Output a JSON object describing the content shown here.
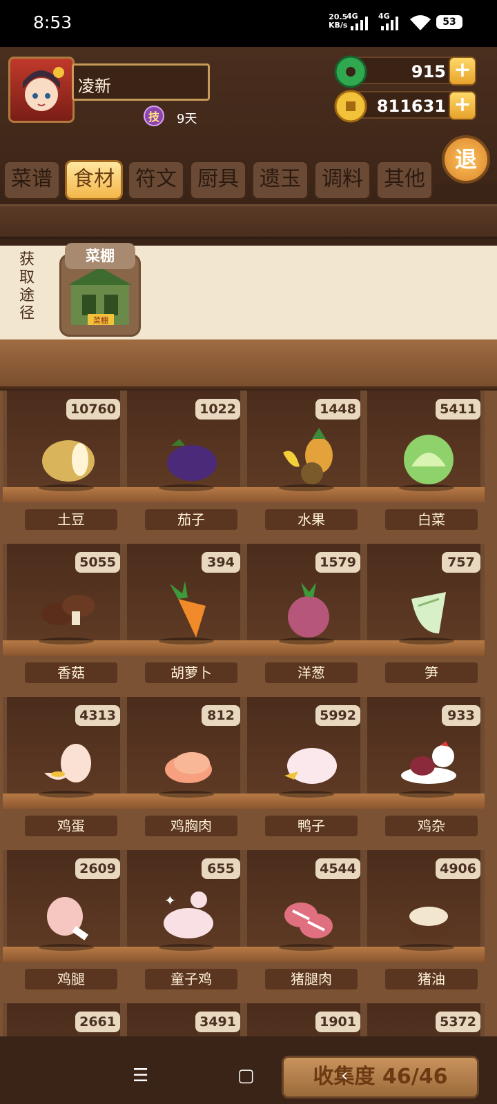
{
  "status_bar": {
    "time": "8:53",
    "net_speed": "20.5",
    "net_unit": "KB/s",
    "signal1": "4G",
    "signal2": "4G",
    "battery": "53"
  },
  "player": {
    "name": "凌新",
    "skill_badge": "技",
    "days": "9天"
  },
  "currency": {
    "jade": "915",
    "coins": "811631"
  },
  "exit_label": "退",
  "tabs": [
    "菜谱",
    "食材",
    "符文",
    "厨具",
    "遗玉",
    "调料",
    "其他"
  ],
  "active_tab": 1,
  "source": {
    "label": "获取途径",
    "title": "菜棚",
    "building_sign": "菜棚"
  },
  "items": [
    {
      "name": "土豆",
      "count": "10760",
      "icon": "potato-icon"
    },
    {
      "name": "茄子",
      "count": "1022",
      "icon": "eggplant-icon"
    },
    {
      "name": "水果",
      "count": "1448",
      "icon": "fruit-icon"
    },
    {
      "name": "白菜",
      "count": "5411",
      "icon": "cabbage-icon"
    },
    {
      "name": "香菇",
      "count": "5055",
      "icon": "mushroom-icon"
    },
    {
      "name": "胡萝卜",
      "count": "394",
      "icon": "carrot-icon"
    },
    {
      "name": "洋葱",
      "count": "1579",
      "icon": "onion-icon"
    },
    {
      "name": "笋",
      "count": "757",
      "icon": "bamboo-shoot-icon"
    },
    {
      "name": "鸡蛋",
      "count": "4313",
      "icon": "egg-icon"
    },
    {
      "name": "鸡胸肉",
      "count": "812",
      "icon": "chicken-breast-icon"
    },
    {
      "name": "鸭子",
      "count": "5992",
      "icon": "duck-icon"
    },
    {
      "name": "鸡杂",
      "count": "933",
      "icon": "chicken-giblets-icon"
    },
    {
      "name": "鸡腿",
      "count": "2609",
      "icon": "drumstick-icon"
    },
    {
      "name": "童子鸡",
      "count": "655",
      "icon": "young-chicken-icon"
    },
    {
      "name": "猪腿肉",
      "count": "4544",
      "icon": "pork-leg-icon"
    },
    {
      "name": "猪油",
      "count": "4906",
      "icon": "lard-icon"
    },
    {
      "name": "",
      "count": "2661",
      "icon": ""
    },
    {
      "name": "",
      "count": "3491",
      "icon": ""
    },
    {
      "name": "",
      "count": "1901",
      "icon": ""
    },
    {
      "name": "",
      "count": "5372",
      "icon": ""
    }
  ],
  "collection": "收集度 46/46",
  "colors": {
    "accent": "#f3b74a",
    "wood": "#7c5234",
    "panel": "#f3e6cf"
  }
}
